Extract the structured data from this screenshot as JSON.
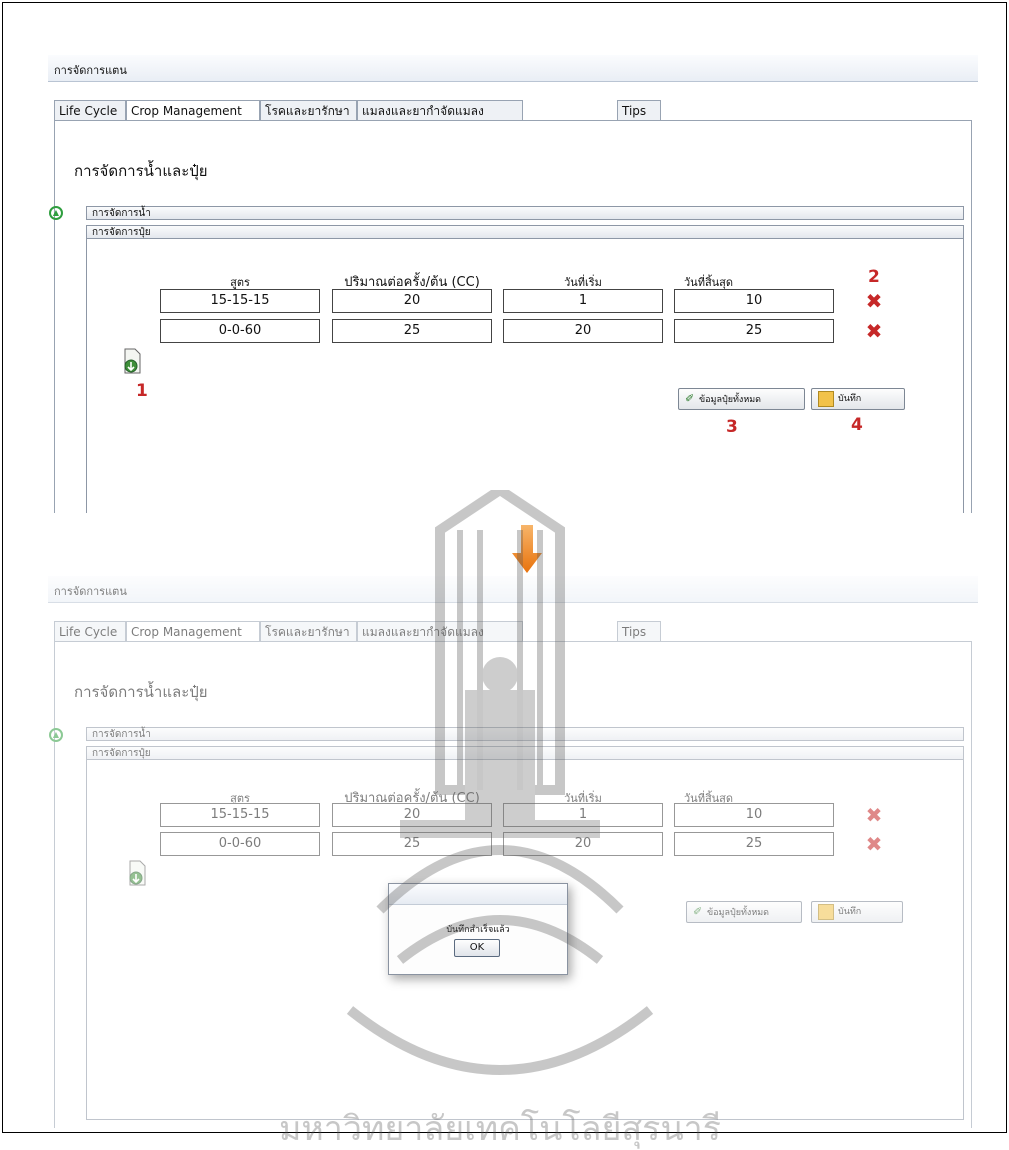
{
  "window": {
    "title": "การจัดการแตน"
  },
  "tabs": [
    "Life Cycle",
    "Crop Management",
    "โรคและยารักษา",
    "แมลงและยากำจัดแมลง",
    "Tips"
  ],
  "section_title": "การจัดการน้ำและปุ๋ย",
  "accordion": {
    "water": "การจัดการน้ำ",
    "fertilizer": "การจัดการปุ๋ย"
  },
  "columns": [
    "สูตร",
    "ปริมาณต่อครั้ง/ต้น (CC)",
    "วันที่เริ่ม",
    "วันที่สิ้นสุด"
  ],
  "rows": [
    {
      "formula": "15-15-15",
      "amount": "20",
      "start": "1",
      "end": "10"
    },
    {
      "formula": "0-0-60",
      "amount": "25",
      "start": "20",
      "end": "25"
    }
  ],
  "buttons": {
    "fertilizer_info": "ข้อมูลปุ๋ยทั้งหมด",
    "save": "บันทึก"
  },
  "annotations": {
    "add": "1",
    "delete": "2",
    "info": "3",
    "save": "4"
  },
  "dialog": {
    "message": "บันทึกสำเร็จแล้ว",
    "ok": "OK"
  },
  "watermark_text": "มหาวิทยาลัยเทคโนโลยีสุรนารี",
  "colors": {
    "annotation": "#c62828",
    "delete_icon": "#c62828",
    "arrow": "#f08a1c",
    "collapse_icon": "#2f9e3f"
  }
}
